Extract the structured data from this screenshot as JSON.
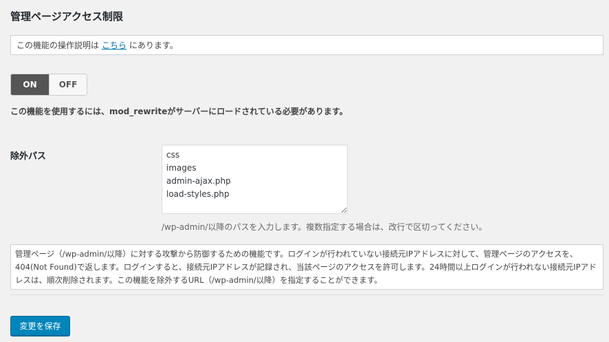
{
  "page": {
    "title": "管理ページアクセス制限"
  },
  "notice": {
    "prefix": "この機能の操作説明は",
    "link_text": "こちら",
    "suffix": "にあります。"
  },
  "toggle": {
    "on_label": "ON",
    "off_label": "OFF",
    "selected": "ON"
  },
  "requirement_note": "この機能を使用するには、mod_rewriteがサーバーにロードされている必要があります。",
  "exclude_paths": {
    "label": "除外パス",
    "value": "css\nimages\nadmin-ajax.php\nload-styles.php",
    "description": "/wp-admin/以降のパスを入力します。複数指定する場合は、改行で区切ってください。"
  },
  "feature_description": "管理ページ（/wp-admin/以降）に対する攻撃から防御するための機能です。ログインが行われていない接続元IPアドレスに対して、管理ページのアクセスを、404(Not Found)で返します。ログインすると、接続元IPアドレスが記録され、当該ページのアクセスを許可します。24時間以上ログインが行われない接続元IPアドレスは、順次削除されます。この機能を除外するURL（/wp-admin/以降）を指定することができます。",
  "save_button": {
    "label": "変更を保存"
  },
  "colors": {
    "primary_button": "#0085ba",
    "link": "#0073aa",
    "toggle_on": "#555555"
  }
}
